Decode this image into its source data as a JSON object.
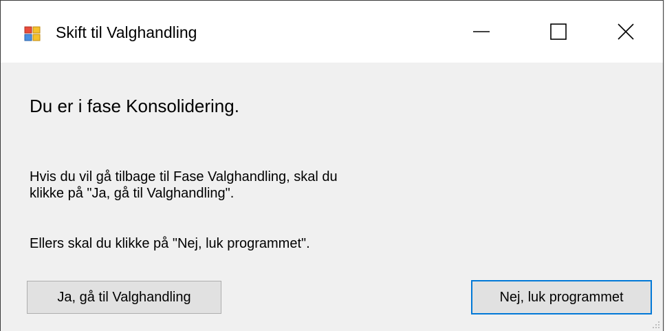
{
  "window": {
    "title": "Skift til Valghandling",
    "icon": "app-window-icon"
  },
  "caption_buttons": {
    "minimize": "minimize-icon",
    "maximize": "maximize-icon",
    "close": "close-icon"
  },
  "content": {
    "phase_text": "Du er i fase Konsolidering.",
    "paragraph_line1": "Hvis du vil gå tilbage til Fase Valghandling, skal du",
    "paragraph_line2": "klikke på \"Ja, gå til Valghandling\".",
    "paragraph_else": "Ellers skal du klikke på \"Nej, luk programmet\"."
  },
  "buttons": {
    "yes_label": "Ja, gå til Valghandling",
    "no_label": "Nej, luk programmet"
  },
  "colors": {
    "focus_border": "#0078d7",
    "button_bg": "#e1e1e1",
    "dialog_bg": "#f0f0f0",
    "titlebar_bg": "#ffffff"
  }
}
